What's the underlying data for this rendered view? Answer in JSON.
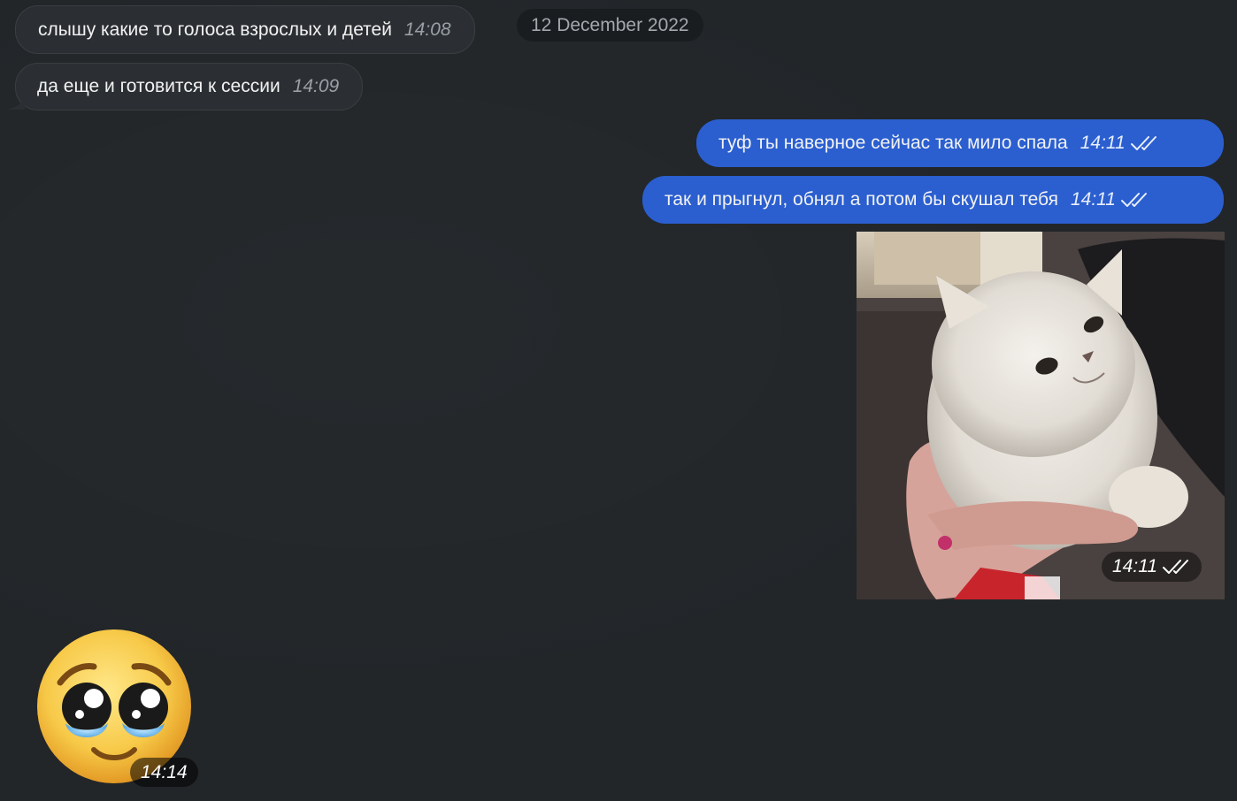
{
  "date_divider": "12 December 2022",
  "messages": [
    {
      "text": "слышу какие то голоса взрослых и детей",
      "time": "14:08"
    },
    {
      "text": "да еще и готовится к сессии",
      "time": "14:09"
    },
    {
      "text": "туф ты наверное сейчас так мило спала",
      "time": "14:11",
      "read": true
    },
    {
      "text": "так и прыгнул, обнял а потом бы скушал тебя",
      "time": "14:11",
      "read": true
    }
  ],
  "video_message": {
    "time": "14:11",
    "read": true,
    "subject": "fluffy white kitten held in a hand"
  },
  "sticker": {
    "emoji": "pleading-face",
    "time": "14:14"
  },
  "colors": {
    "background": "#222629",
    "incoming_bubble": "#2b2f33",
    "outgoing_bubble": "#2b5fd0"
  }
}
